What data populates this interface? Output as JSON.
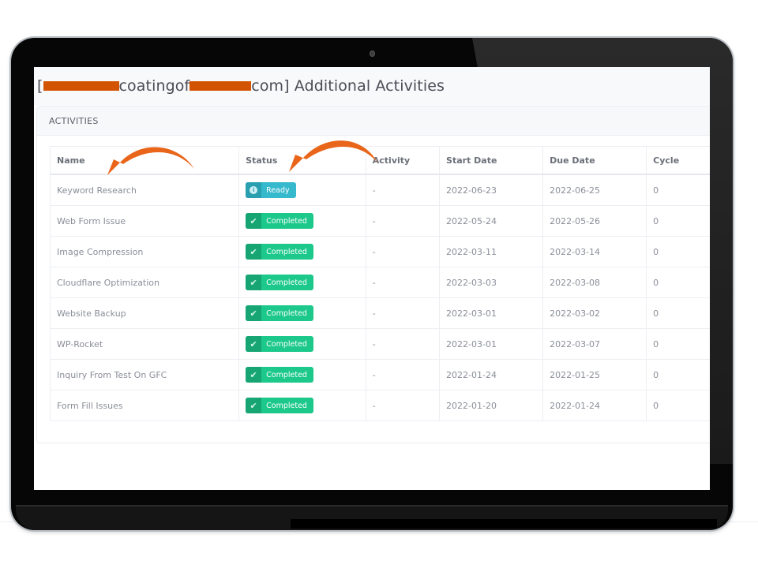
{
  "page": {
    "title_prefix": "[",
    "title_mid": "coatingof",
    "title_suffix": "com] Additional Activities",
    "redaction_color": "#d35400"
  },
  "card": {
    "header": "ACTIVITIES"
  },
  "table": {
    "columns": [
      "Name",
      "Status",
      "Activity",
      "Start Date",
      "Due Date",
      "Cycle"
    ],
    "rows": [
      {
        "name": "Keyword Research",
        "status": "Ready",
        "activity": "-",
        "start": "2022-06-23",
        "due": "2022-06-25",
        "cycle": "0"
      },
      {
        "name": "Web Form Issue",
        "status": "Completed",
        "activity": "-",
        "start": "2022-05-24",
        "due": "2022-05-26",
        "cycle": "0"
      },
      {
        "name": "Image Compression",
        "status": "Completed",
        "activity": "-",
        "start": "2022-03-11",
        "due": "2022-03-14",
        "cycle": "0"
      },
      {
        "name": "Cloudflare Optimization",
        "status": "Completed",
        "activity": "-",
        "start": "2022-03-03",
        "due": "2022-03-08",
        "cycle": "0"
      },
      {
        "name": "Website Backup",
        "status": "Completed",
        "activity": "-",
        "start": "2022-03-01",
        "due": "2022-03-02",
        "cycle": "0"
      },
      {
        "name": "WP-Rocket",
        "status": "Completed",
        "activity": "-",
        "start": "2022-03-01",
        "due": "2022-03-07",
        "cycle": "0"
      },
      {
        "name": "Inquiry From Test On GFC",
        "status": "Completed",
        "activity": "-",
        "start": "2022-01-24",
        "due": "2022-01-25",
        "cycle": "0"
      },
      {
        "name": "Form Fill Issues",
        "status": "Completed",
        "activity": "-",
        "start": "2022-01-20",
        "due": "2022-01-24",
        "cycle": "0"
      }
    ]
  },
  "status_styles": {
    "Ready": {
      "class": "ready",
      "icon": "info-icon",
      "color": "#36b9cc"
    },
    "Completed": {
      "class": "completed",
      "icon": "check-icon",
      "color": "#1cc88a"
    }
  },
  "annotations": {
    "arrow_color": "#e8651a",
    "targets": [
      "name-column",
      "status-column"
    ]
  }
}
